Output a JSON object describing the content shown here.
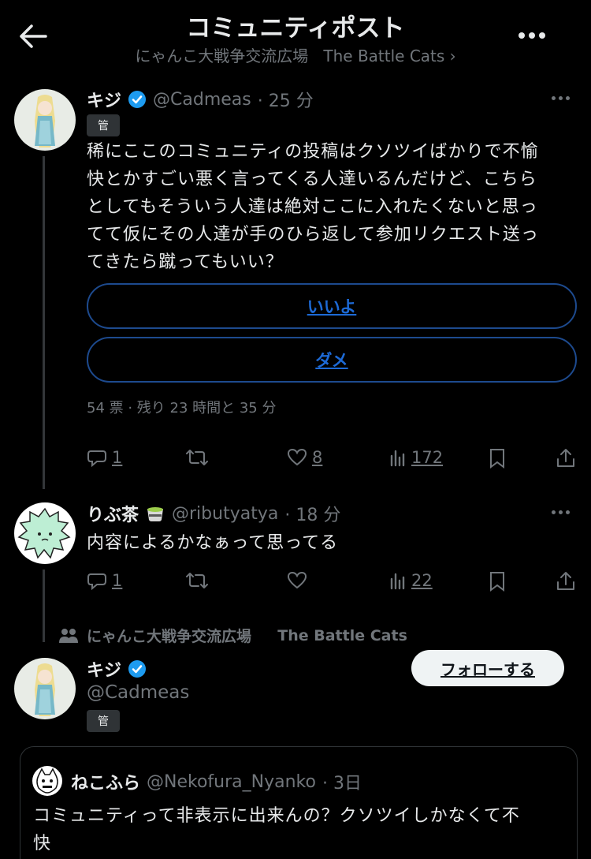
{
  "header": {
    "title": "コミュニティポスト",
    "community_name": "にゃんこ大戦争交流広場",
    "community_sub": "The Battle Cats ›"
  },
  "post1": {
    "name": "キジ",
    "handle": "@Cadmeas",
    "time": "· 25 分",
    "badge": "管",
    "lines": [
      "稀にここのコミュニティの投稿はクソツイばかりで不愉",
      "快とかすごい悪く言ってくる人達いるんだけど、こちら",
      "としてもそういう人達は絶対ここに入れたくないと思っ",
      "てて仮にその人達が手のひら返して参加リクエスト送っ",
      "てきたら蹴ってもいい？"
    ],
    "poll_options": [
      "いいよ",
      "ダメ"
    ],
    "poll_meta": "54 票 · 残り 23 時間と 35 分",
    "replies": "1",
    "likes": "8",
    "views": "172"
  },
  "post2": {
    "name": "りぶ茶",
    "handle": "@ributyatya",
    "time": "· 18 分",
    "text": "内容によるかなぁって思ってる",
    "replies": "1",
    "views": "22"
  },
  "community_label": {
    "name": "にゃんこ大戦争交流広場",
    "sub": "The Battle Cats"
  },
  "post3": {
    "name": "キジ",
    "handle": "@Cadmeas",
    "badge": "管",
    "follow_label": "フォローする"
  },
  "quote": {
    "name": "ねこふら",
    "handle": "@Nekofura_Nyanko",
    "time": "· 3日",
    "line1": "コミュニティって非表示に出来んの？クソツイしかなくて不",
    "line2": "快"
  },
  "colors": {
    "accent": "#1d9bf0",
    "muted": "#71767b",
    "poll_border": "#1d4a8e"
  }
}
